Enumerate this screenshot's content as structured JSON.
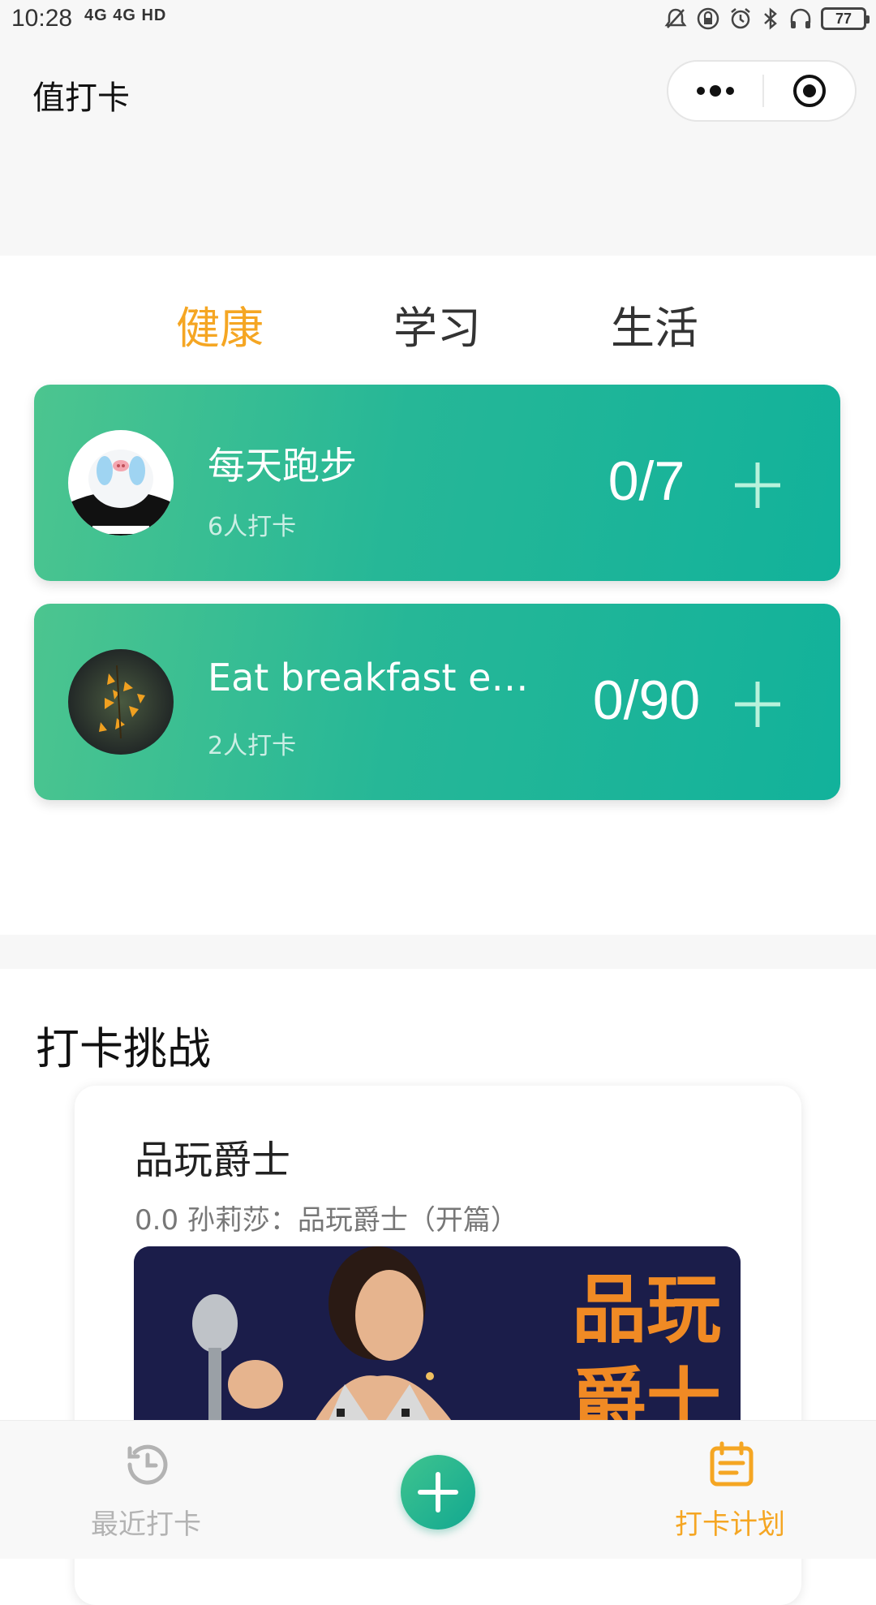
{
  "status_bar": {
    "time": "10:28",
    "signal": "4G 4G HD",
    "battery": "77"
  },
  "header": {
    "title": "值打卡"
  },
  "tabs": [
    {
      "label": "健康",
      "active": true
    },
    {
      "label": "学习",
      "active": false
    },
    {
      "label": "生活",
      "active": false
    }
  ],
  "plans": [
    {
      "title": "每天跑步",
      "participants": "6人打卡",
      "progress": "0/7"
    },
    {
      "title": "Eat breakfast every day",
      "participants": "2人打卡",
      "progress": "0/90"
    }
  ],
  "challenges": {
    "section_title": "打卡挑战",
    "items": [
      {
        "title": "品玩爵士",
        "subtitle": "0.0 孙莉莎：品玩爵士（开篇）",
        "cover_text": "品玩爵士"
      }
    ]
  },
  "tabbar": {
    "items": [
      {
        "label": "最近打卡",
        "active": false
      },
      {
        "label": "打卡计划",
        "active": true
      }
    ]
  },
  "colors": {
    "accent": "#f5a623",
    "card_green": "#1fb59a",
    "inactive": "#b3b3b3"
  }
}
